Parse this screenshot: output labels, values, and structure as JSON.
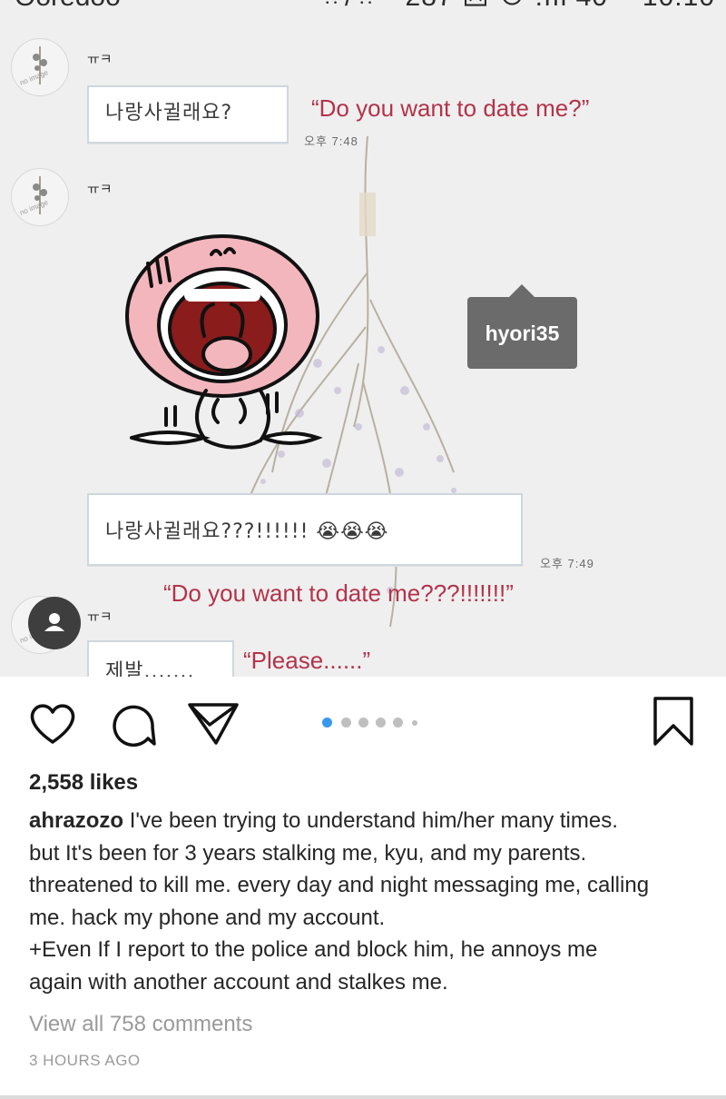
{
  "status_bar": {
    "carrier": "Ooredoo",
    "indicators": "ᄋᆢ/ᄋᆢᄋ287 ⊠ ⊙ .ııl 40ᄼ 10:10"
  },
  "chat": {
    "sender_name": "ㅠㅋ",
    "avatar_text": "no image",
    "messages": [
      {
        "text": "나랑사귈래요?",
        "time": "오후 7:48",
        "translation": "“Do you want to date me?”"
      },
      {
        "text": "나랑사귈래요???!!!!!! 😭😭😭",
        "time": "오후 7:49",
        "translation": "“Do you want to date me???!!!!!!!”"
      },
      {
        "text": "제발.......",
        "translation": "“Please......”"
      }
    ],
    "tooltip": "hyori35"
  },
  "post": {
    "likes": "2,558 likes",
    "username": "ahrazozo",
    "caption_lines": [
      "I've been trying to understand him/her many times.",
      "but It's been for 3 years stalking me, kyu, and my parents.",
      "threatened to kill me. every day and night messaging me, calling",
      "me. hack my phone and my account.",
      "+Even If I report to the police and block him, he annoys me",
      "again with another account and stalkes me."
    ],
    "view_comments": "View all 758 comments",
    "time_ago": "3 HOURS AGO",
    "carousel": {
      "count": 6,
      "active_index": 0
    },
    "icons": [
      "heart-icon",
      "comment-icon",
      "share-icon",
      "bookmark-icon"
    ]
  },
  "colors": {
    "caption_red": "#b3334a",
    "accent_blue": "#3897f0"
  }
}
